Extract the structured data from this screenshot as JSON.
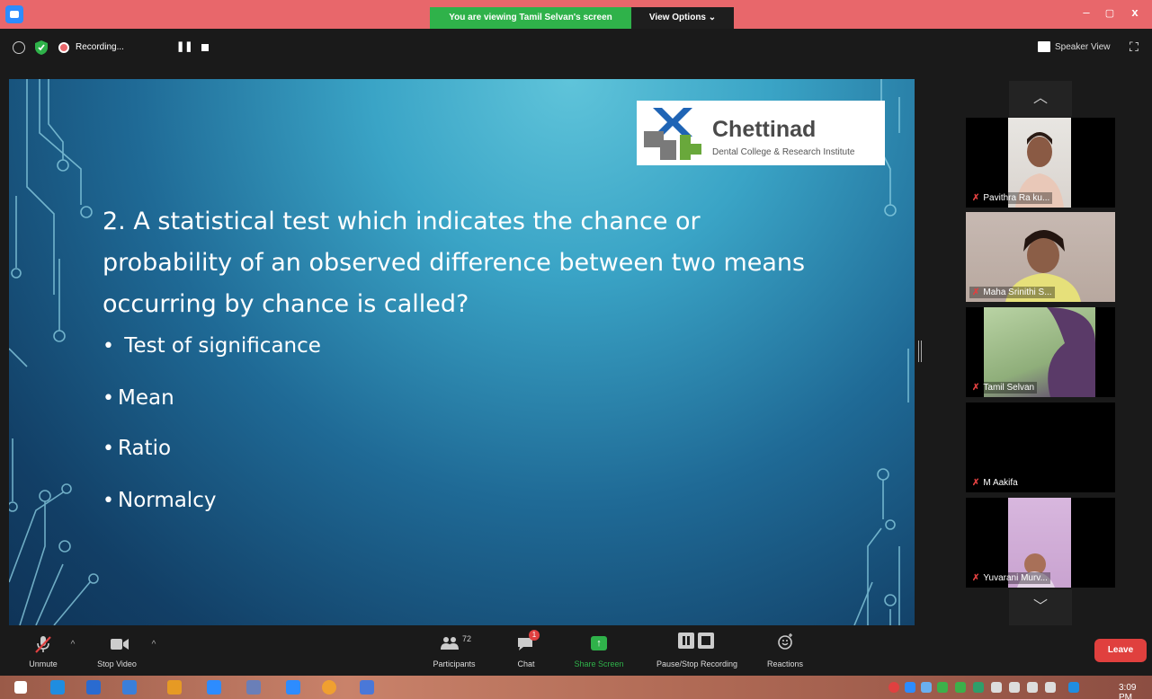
{
  "titlebar": {
    "viewing_banner": "You are viewing Tamil Selvan's screen",
    "view_options": "View Options ⌄",
    "minimize": "–",
    "maximize": "▢",
    "close": "x"
  },
  "topbar": {
    "recording_label": "Recording...",
    "pause_glyph": "❚❚",
    "speaker_view": "Speaker View"
  },
  "slide": {
    "logo_name": "Chettinad",
    "logo_sub": "Dental College & Research Institute",
    "question": "2. A statistical test which indicates the chance or probability of an observed difference between two means occurring by chance is called?",
    "options": [
      "Test of significance",
      "Mean",
      "Ratio",
      "Normalcy"
    ]
  },
  "participants": [
    {
      "name": "Pavithra Ra ku..."
    },
    {
      "name": "Maha Srinithi S..."
    },
    {
      "name": "Tamil Selvan"
    },
    {
      "name": "M Aakifa"
    },
    {
      "name": "Yuvarani Murv..."
    }
  ],
  "toolbar": {
    "unmute": "Unmute",
    "stop_video": "Stop Video",
    "participants": "Participants",
    "participants_count": "72",
    "chat": "Chat",
    "chat_badge": "1",
    "share_screen": "Share Screen",
    "pause_stop_recording": "Pause/Stop Recording",
    "reactions": "Reactions",
    "leave": "Leave"
  },
  "taskbar": {
    "clock": "3:09 PM"
  },
  "colors": {
    "titlebar": "#e8676b",
    "share_green": "#2fb24a",
    "leave_red": "#e0403e"
  }
}
